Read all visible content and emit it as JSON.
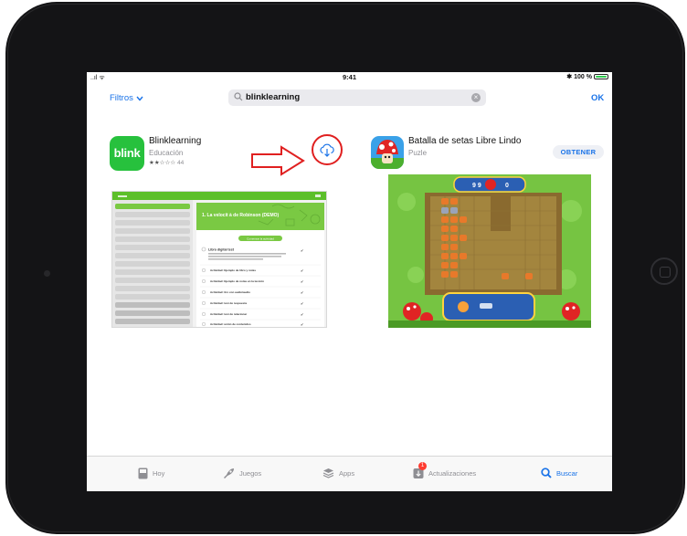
{
  "status_bar": {
    "signal": "..ıl ᯤ",
    "time": "9:41",
    "bluetooth": "✱",
    "battery_percent": "100 %",
    "battery_level": 1.0
  },
  "search": {
    "filters_label": "Filtros",
    "query": "blinklearning",
    "ok_label": "OK"
  },
  "results": [
    {
      "name": "Blinklearning",
      "category": "Educación",
      "icon_text": "blink",
      "rating_stars": "★★☆☆☆",
      "rating_count": "44",
      "screenshot": {
        "header_title": "1. La velocit à de Robinson (DEMO)",
        "button_label": "Comenzar la actividad",
        "section_title": "Libro digital test",
        "list_items": [
          "Actividad: Ejemplo de libro y notas",
          "Actividad: Ejemplo de notas en la lección",
          "Actividad: tiro con audio/audio",
          "Actividad: test de respuesta",
          "Actividad: test de relacionar",
          "Actividad: unión de contenidos"
        ]
      },
      "accent_color": "#27c13d"
    },
    {
      "name": "Batalla de setas Libre Lindo",
      "category": "Puzle",
      "action_label": "OBTENER",
      "screenshot": {
        "score_left": "9 9",
        "score_right": "0"
      }
    }
  ],
  "tabs": [
    {
      "label": "Hoy",
      "icon": "today-icon"
    },
    {
      "label": "Juegos",
      "icon": "games-rocket-icon"
    },
    {
      "label": "Apps",
      "icon": "apps-stack-icon"
    },
    {
      "label": "Actualizaciones",
      "icon": "updates-download-icon",
      "badge": "1"
    },
    {
      "label": "Buscar",
      "icon": "search-icon",
      "active": true
    }
  ],
  "colors": {
    "accent": "#1a73e8",
    "annotation": "#e02020",
    "blink_green": "#27c13d"
  }
}
